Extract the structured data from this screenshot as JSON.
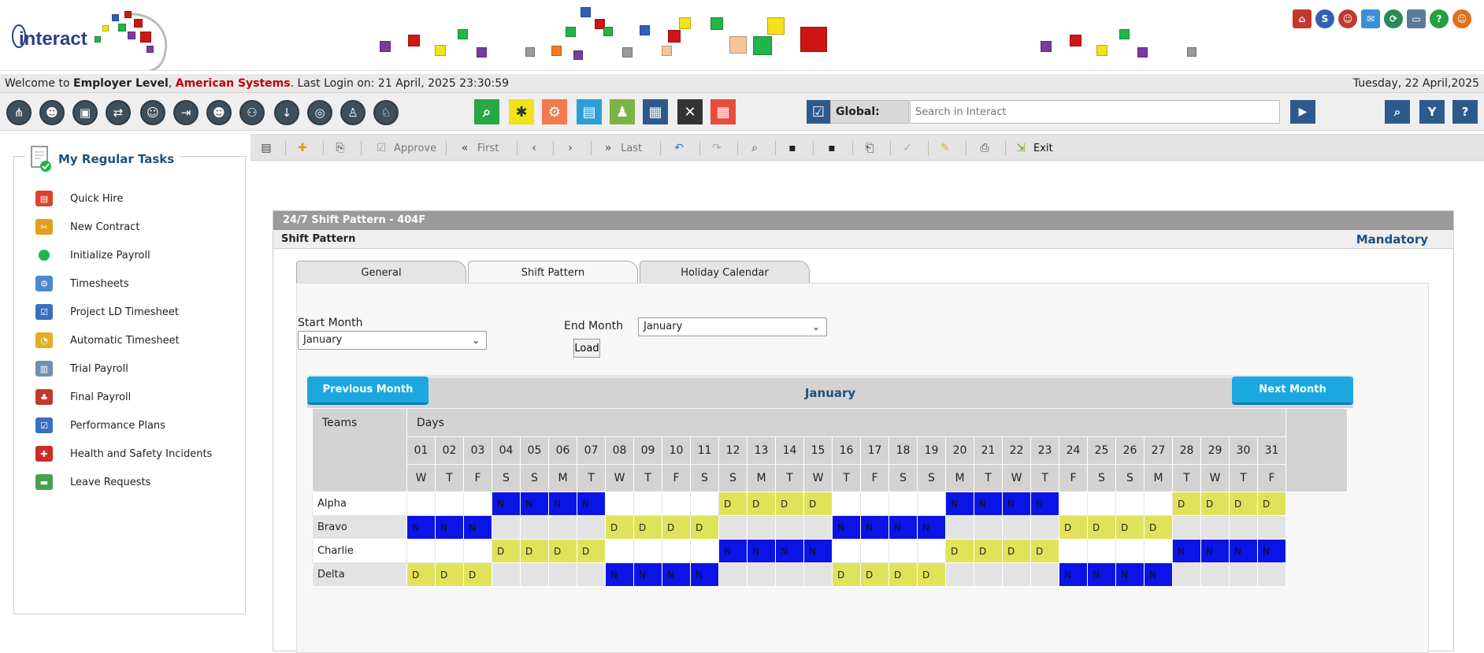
{
  "header": {
    "logo_text": "interact",
    "colors": {
      "red": "#d01515",
      "yellow": "#f2e21a",
      "green": "#22b54a",
      "purple": "#7b3aa0",
      "blue": "#2f62b5",
      "grey": "#9a9a9a",
      "peach": "#f5c69a",
      "orange": "#f07b22"
    },
    "top_icons": [
      "home-icon",
      "help-circle-icon",
      "user-icon",
      "mail-icon",
      "sync-icon",
      "computer-icon",
      "question-icon",
      "user-add-icon"
    ]
  },
  "welcome": {
    "prefix": "Welcome to ",
    "employer": "Employer Level",
    "sep": ", ",
    "company": "American Systems",
    "last_login": ". Last Login on: 21 April, 2025 23:30:59",
    "today": "Tuesday, 22 April,2025"
  },
  "toolbar": {
    "global_label": "Global:",
    "search_placeholder": "Search in Interact"
  },
  "tasks": {
    "title": "My Regular Tasks",
    "items": [
      {
        "label": "Quick Hire",
        "icon": "quick-hire-icon",
        "color": "#d9442a"
      },
      {
        "label": "New Contract",
        "icon": "contract-icon",
        "color": "#e0a020"
      },
      {
        "label": "Initialize Payroll",
        "icon": "green-dot-icon",
        "color": "#22b54a"
      },
      {
        "label": "Timesheets",
        "icon": "timesheets-icon",
        "color": "#4a8acd"
      },
      {
        "label": "Project LD Timesheet",
        "icon": "checklist-icon",
        "color": "#3a6fc2"
      },
      {
        "label": "Automatic Timesheet",
        "icon": "auto-timesheet-icon",
        "color": "#e0b020"
      },
      {
        "label": "Trial Payroll",
        "icon": "trial-payroll-icon",
        "color": "#6f8fb8"
      },
      {
        "label": "Final Payroll",
        "icon": "final-payroll-icon",
        "color": "#c4382a"
      },
      {
        "label": "Performance Plans",
        "icon": "checklist-icon",
        "color": "#3a6fc2"
      },
      {
        "label": "Health and Safety Incidents",
        "icon": "health-cross-icon",
        "color": "#d02a2a"
      },
      {
        "label": "Leave Requests",
        "icon": "leave-icon",
        "color": "#4aa050"
      }
    ]
  },
  "actions": {
    "approve": "Approve",
    "first": "First",
    "last": "Last",
    "exit": "Exit"
  },
  "panel": {
    "title": "24/7 Shift Pattern - 404F",
    "subtitle": "Shift Pattern",
    "mandatory": "Mandatory",
    "tabs": [
      "General",
      "Shift Pattern",
      "Holiday Calendar"
    ],
    "start_month_label": "Start Month",
    "start_month_value": "January",
    "end_month_label": "End Month",
    "end_month_value": "January",
    "load_label": "Load"
  },
  "calendar": {
    "prev_label": "Previous Month",
    "next_label": "Next Month",
    "month": "January",
    "teams_header": "Teams",
    "days_header": "Days",
    "days": [
      "01",
      "02",
      "03",
      "04",
      "05",
      "06",
      "07",
      "08",
      "09",
      "10",
      "11",
      "12",
      "13",
      "14",
      "15",
      "16",
      "17",
      "18",
      "19",
      "20",
      "21",
      "22",
      "23",
      "24",
      "25",
      "26",
      "27",
      "28",
      "29",
      "30",
      "31"
    ],
    "weekdays": [
      "W",
      "T",
      "F",
      "S",
      "S",
      "M",
      "T",
      "W",
      "T",
      "F",
      "S",
      "S",
      "M",
      "T",
      "W",
      "T",
      "F",
      "S",
      "S",
      "M",
      "T",
      "W",
      "T",
      "F",
      "S",
      "S",
      "M",
      "T",
      "W",
      "T",
      "F"
    ],
    "colors": {
      "N": "#0a14e6",
      "D": "#e0e35a"
    },
    "teams": [
      {
        "name": "Alpha",
        "shifts": [
          "",
          "",
          "",
          "N",
          "N",
          "N",
          "N",
          "",
          "",
          "",
          "",
          "D",
          "D",
          "D",
          "D",
          "",
          "",
          "",
          "",
          "N",
          "N",
          "N",
          "N",
          "",
          "",
          "",
          "",
          "D",
          "D",
          "D",
          "D"
        ]
      },
      {
        "name": "Bravo",
        "shifts": [
          "N",
          "N",
          "N",
          "",
          "",
          "",
          "",
          "D",
          "D",
          "D",
          "D",
          "",
          "",
          "",
          "",
          "N",
          "N",
          "N",
          "N",
          "",
          "",
          "",
          "",
          "D",
          "D",
          "D",
          "D",
          "",
          "",
          "",
          ""
        ]
      },
      {
        "name": "Charlie",
        "shifts": [
          "",
          "",
          "",
          "D",
          "D",
          "D",
          "D",
          "",
          "",
          "",
          "",
          "N",
          "N",
          "N",
          "N",
          "",
          "",
          "",
          "",
          "D",
          "D",
          "D",
          "D",
          "",
          "",
          "",
          "",
          "N",
          "N",
          "N",
          "N"
        ]
      },
      {
        "name": "Delta",
        "shifts": [
          "D",
          "D",
          "D",
          "",
          "",
          "",
          "",
          "N",
          "N",
          "N",
          "N",
          "",
          "",
          "",
          "",
          "D",
          "D",
          "D",
          "D",
          "",
          "",
          "",
          "",
          "N",
          "N",
          "N",
          "N",
          "",
          "",
          "",
          ""
        ]
      }
    ]
  }
}
